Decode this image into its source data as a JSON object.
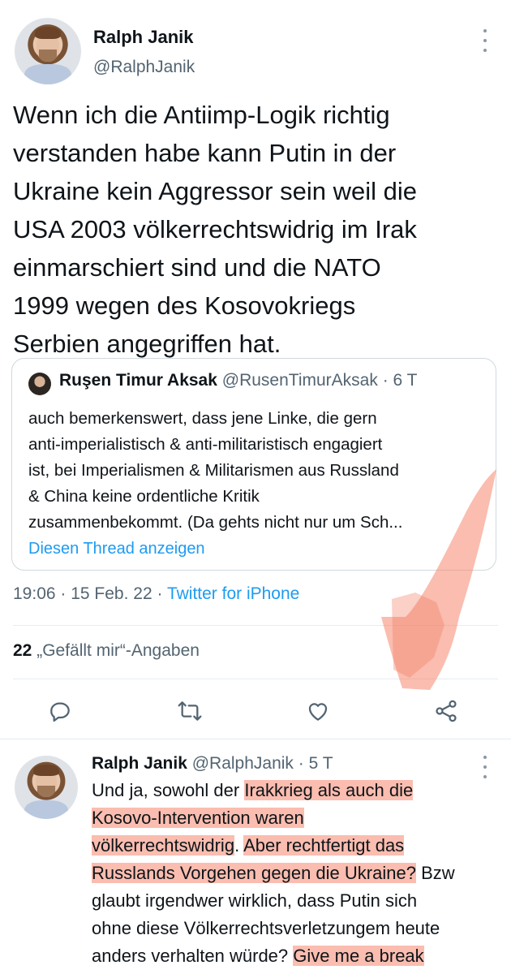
{
  "tweet": {
    "author_name": "Ralph Janik",
    "author_handle": "@RalphJanik",
    "text_lines": [
      "Wenn ich die Antiimp-Logik richtig",
      "verstanden habe kann Putin in der",
      "Ukraine kein Aggressor sein weil die",
      "USA 2003 völkerrechtswidrig im Irak",
      "einmarschiert sind und die NATO",
      "1999 wegen des Kosovokriegs",
      "Serbien angegriffen hat."
    ],
    "time": "19:06",
    "date": "15 Feb. 22",
    "source": "Twitter for iPhone",
    "likes_count": "22",
    "likes_label": "„Gefällt mir“-Angaben"
  },
  "quote": {
    "author_name": "Ruşen Timur Aksak",
    "author_handle": "@RusenTimurAksak",
    "age": "· 6 T",
    "text_lines": [
      "auch bemerkenswert, dass jene Linke, die gern",
      "anti-imperialistisch & anti-militaristisch engagiert",
      "ist, bei Imperialismen & Militarismen aus Russland",
      "& China keine ordentliche Kritik",
      "zusammenbekommt. (Da gehts nicht nur um Sch..."
    ],
    "thread_link": "Diesen Thread anzeigen"
  },
  "reply": {
    "author_name": "Ralph Janik",
    "author_handle": "@RalphJanik",
    "age": "· 5 T",
    "line1_a": "Und ja, sowohl der ",
    "line1_b": "Irakkrieg als auch die",
    "line2": "Kosovo-Intervention waren",
    "line3_a": "völkerrechtswidrig",
    "line3_b": ". ",
    "line3_c": "Aber rechtfertigt das",
    "line4_a": "Russlands Vorgehen gegen die Ukraine?",
    "line4_b": " Bzw",
    "line5": "glaubt irgendwer wirklich, dass Putin sich",
    "line6": "ohne diese Völkerrechtsverletzungem heute",
    "line7_a": "anders verhalten würde? ",
    "line7_b": "Give me a break"
  },
  "colors": {
    "accent": "#1d9bf0",
    "secondary_text": "#536471",
    "highlight": "#f5876e"
  },
  "icons": [
    "more-icon",
    "reply-icon",
    "retweet-icon",
    "like-icon",
    "share-icon"
  ]
}
